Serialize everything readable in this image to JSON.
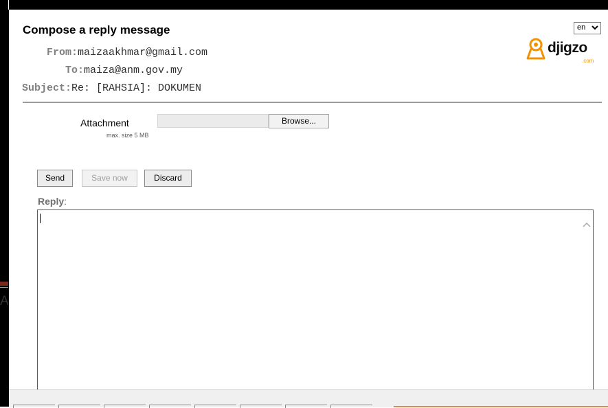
{
  "dialog": {
    "title": "Compose a reply message",
    "language": "en"
  },
  "brand": {
    "name": "djigzo",
    "suffix": ".com",
    "accent_color": "#f39200"
  },
  "headers": {
    "from_label": "From:",
    "from_value": "maizaakhmar@gmail.com",
    "to_label": "To:",
    "to_value": "maiza@anm.gov.my",
    "subject_label": "Subject:",
    "subject_value": "Re: [RAHSIA]: DOKUMEN"
  },
  "attachment": {
    "label": "Attachment",
    "note": "max. size 5 MB",
    "browse_label": "Browse..."
  },
  "actions": {
    "send": "Send",
    "save_now": "Save now",
    "discard": "Discard"
  },
  "reply": {
    "label": "Reply",
    "suffix": ":",
    "value": ""
  },
  "background": {
    "partial_text": "A"
  }
}
